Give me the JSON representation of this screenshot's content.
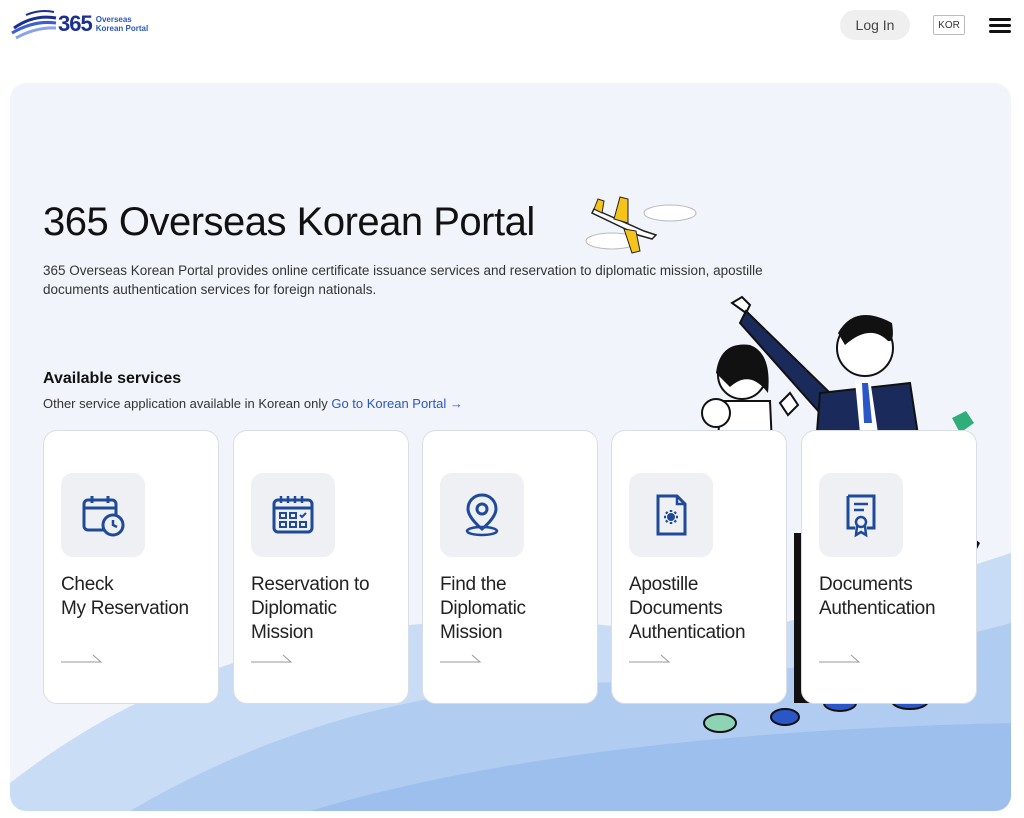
{
  "header": {
    "logo_number": "365",
    "logo_line1": "Overseas",
    "logo_line2": "Korean Portal",
    "login_label": "Log In",
    "lang_label": "KOR"
  },
  "hero": {
    "title": "365 Overseas Korean Portal",
    "description": "365 Overseas Korean Portal provides online certificate issuance services and reservation to diplomatic mission, apostille documents authentication services for foreign nationals."
  },
  "services": {
    "heading": "Available services",
    "subtext": "Other service application available in Korean only ",
    "link_label": "Go to Korean Portal →",
    "cards": [
      {
        "label": "Check\nMy Reservation",
        "icon": "calendar-clock-icon"
      },
      {
        "label": "Reservation to\nDiplomatic\nMission",
        "icon": "calendar-check-icon"
      },
      {
        "label": "Find the\nDiplomatic\nMission",
        "icon": "map-pin-icon"
      },
      {
        "label": "Apostille\nDocuments\nAuthentication",
        "icon": "document-gear-icon"
      },
      {
        "label": "Documents\nAuthentication",
        "icon": "certificate-icon"
      }
    ]
  },
  "colors": {
    "brand_blue": "#1b2f8f",
    "link_blue": "#2a56c6",
    "icon_blue": "#1f4a9a",
    "hero_bg": "#f1f5fb"
  }
}
